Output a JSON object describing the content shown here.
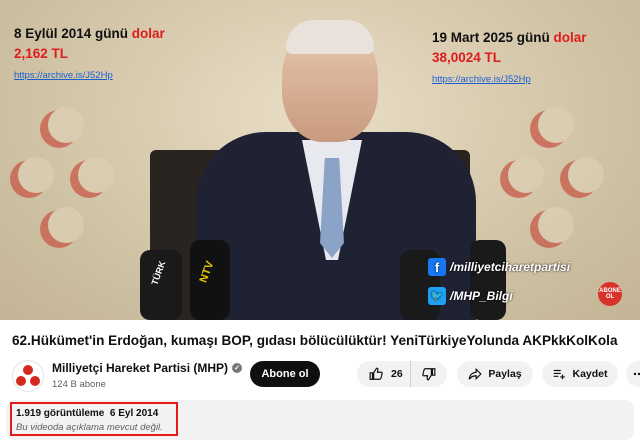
{
  "video_overlay": {
    "left_date_prefix": "8 Eylül 2014 günü ",
    "left_date_word": "dolar",
    "left_price": "2,162 TL",
    "left_link": "https://archive.is/J52Hp",
    "right_date_prefix": "19 Mart 2025 günü ",
    "right_date_word": "dolar",
    "right_price": "38,0024 TL",
    "right_link": "https://archive.is/J52Hp",
    "facebook_handle": "/milliyetciharetpartisi",
    "twitter_handle": "/MHP_Bilgi",
    "abone_badge": "ABONE OL",
    "mic_label": "TÜRK",
    "mic_label_2": "NTV"
  },
  "video": {
    "title": "62.Hükümet'in Erdoğan, kumaşı BOP, gıdası bölücülüktür! YeniTürkiyeYolunda AKPkkKolKola"
  },
  "channel": {
    "name": "Milliyetçi Hareket Partisi (MHP)",
    "verified_mark": "✓",
    "subscribers": "124 B abone",
    "subscribe_label": "Abone ol"
  },
  "actions": {
    "like_count": "26",
    "share_label": "Paylaş",
    "save_label": "Kaydet"
  },
  "description": {
    "views_and_date": "1.919 görüntüleme  6 Eyl 2014",
    "no_description": "Bu videoda açıklama mevcut değil."
  },
  "icons": {
    "like": "thumbs-up-icon",
    "dislike": "thumbs-down-icon",
    "share": "share-arrow-icon",
    "save": "save-plus-icon",
    "more": "more-dots-icon",
    "verified": "check-icon",
    "facebook": "facebook-icon",
    "twitter": "twitter-icon"
  },
  "colors": {
    "accent_red": "#e01b1b",
    "link_blue": "#1a5fd0",
    "subscribe_bg": "#0f0f0f",
    "pill_bg": "#f2f2f2",
    "facebook": "#1877f2",
    "twitter": "#1da1f2"
  }
}
